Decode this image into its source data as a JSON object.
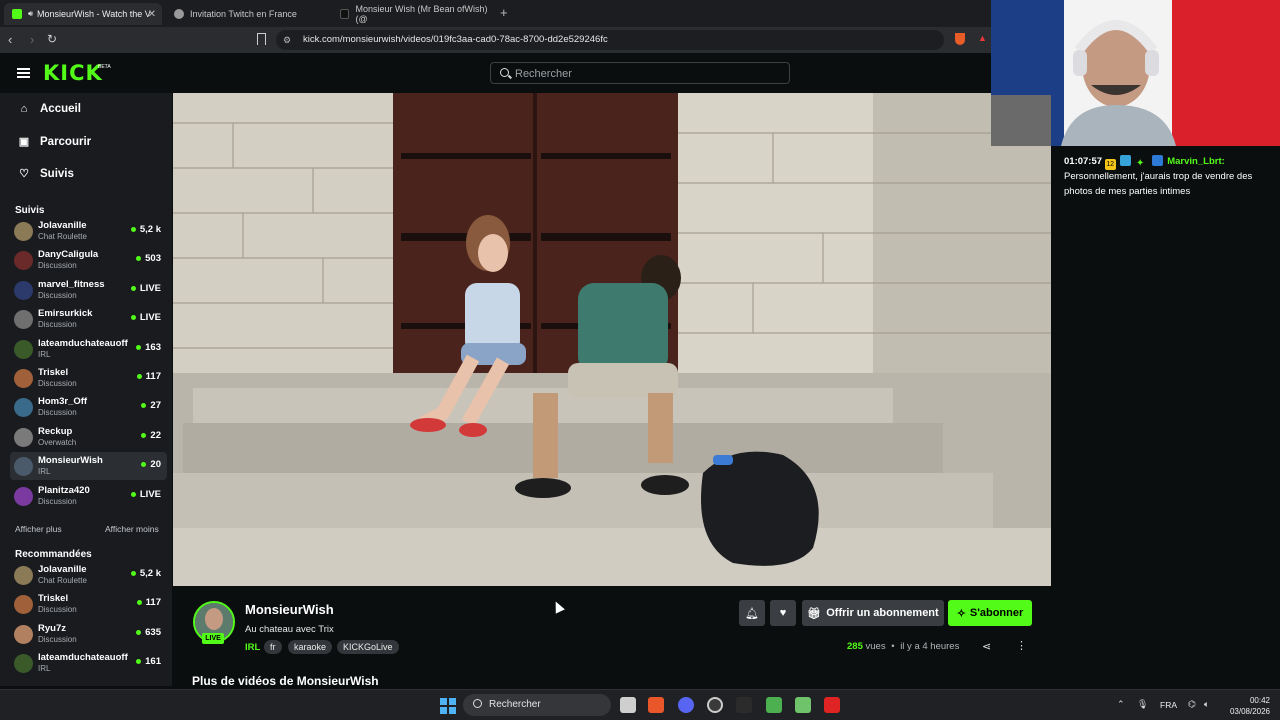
{
  "browser": {
    "tabs": [
      {
        "title": "MonsieurWish - Watch the V",
        "active": true
      },
      {
        "title": "Invitation Twitch en France",
        "active": false
      },
      {
        "title": "Monsieur Wish (Mr Bean ofWish) (@",
        "active": false
      }
    ],
    "url": "kick.com/monsieurwish/videos/019fc3aa-cad0-78ac-8700-dd2e529246fc"
  },
  "header": {
    "logo": "KICK",
    "logo_beta": "BETA",
    "search_placeholder": "Rechercher"
  },
  "sidebar": {
    "nav": [
      {
        "label": "Accueil",
        "icon": "home-icon"
      },
      {
        "label": "Parcourir",
        "icon": "browse-icon"
      },
      {
        "label": "Suivis",
        "icon": "heart-icon"
      }
    ],
    "following_title": "Suivis",
    "following": [
      {
        "name": "Jolavanille",
        "category": "Chat Roulette",
        "viewers": "5,2 k",
        "color": "#8a7a55"
      },
      {
        "name": "DanyCaligula",
        "category": "Discussion",
        "viewers": "503",
        "color": "#6b2a2a"
      },
      {
        "name": "marvel_fitness",
        "category": "Discussion",
        "viewers": "LIVE",
        "color": "#2c3a6b"
      },
      {
        "name": "Emirsurkick",
        "category": "Discussion",
        "viewers": "LIVE",
        "color": "#6f6f6f"
      },
      {
        "name": "lateamduchateauoff",
        "category": "IRL",
        "viewers": "163",
        "color": "#3b5a2a"
      },
      {
        "name": "Triskel",
        "category": "Discussion",
        "viewers": "117",
        "color": "#a0603a"
      },
      {
        "name": "Hom3r_Off",
        "category": "Discussion",
        "viewers": "27",
        "color": "#3a6a8a"
      },
      {
        "name": "Reckup",
        "category": "Overwatch",
        "viewers": "22",
        "color": "#7a7a7a"
      },
      {
        "name": "MonsieurWish",
        "category": "IRL",
        "viewers": "20",
        "color": "#4a5a6a",
        "selected": true
      },
      {
        "name": "Planitza420",
        "category": "Discussion",
        "viewers": "LIVE",
        "color": "#7a3aa0"
      }
    ],
    "show_more": "Afficher plus",
    "show_less": "Afficher moins",
    "recommended_title": "Recommandées",
    "recommended": [
      {
        "name": "Jolavanille",
        "category": "Chat Roulette",
        "viewers": "5,2 k",
        "color": "#8a7a55"
      },
      {
        "name": "Triskel",
        "category": "Discussion",
        "viewers": "117",
        "color": "#a0603a"
      },
      {
        "name": "Ryu7z",
        "category": "Discussion",
        "viewers": "635",
        "color": "#b08060"
      },
      {
        "name": "lateamduchateauoff",
        "category": "IRL",
        "viewers": "161",
        "color": "#3b5a2a"
      }
    ]
  },
  "chat": {
    "timestamp": "01:07:57",
    "badge_text": "12",
    "username": "Marvin_Lbrt:",
    "message": "Personnellement, j'aurais trop de vendre des photos de mes parties intimes"
  },
  "video_info": {
    "streamer": "MonsieurWish",
    "live_label": "LIVE",
    "title": "Au chateau avec Trix",
    "category": "IRL",
    "tags": [
      "fr",
      "karaoke",
      "KICKGoLive"
    ],
    "gift_label": "Offrir un abonnement",
    "subscribe_label": "S'abonner",
    "views_count": "285",
    "views_label": "vues",
    "time_ago": "il y a 4 heures",
    "more_videos_title": "Plus de vidéos de MonsieurWish"
  },
  "taskbar": {
    "search": "Rechercher",
    "lang": "FRA",
    "time": "00:42",
    "date": "03/08/2026"
  },
  "colors": {
    "accent": "#53fc18",
    "background": "#0b0e0f",
    "sidebar": "#191b1f"
  }
}
